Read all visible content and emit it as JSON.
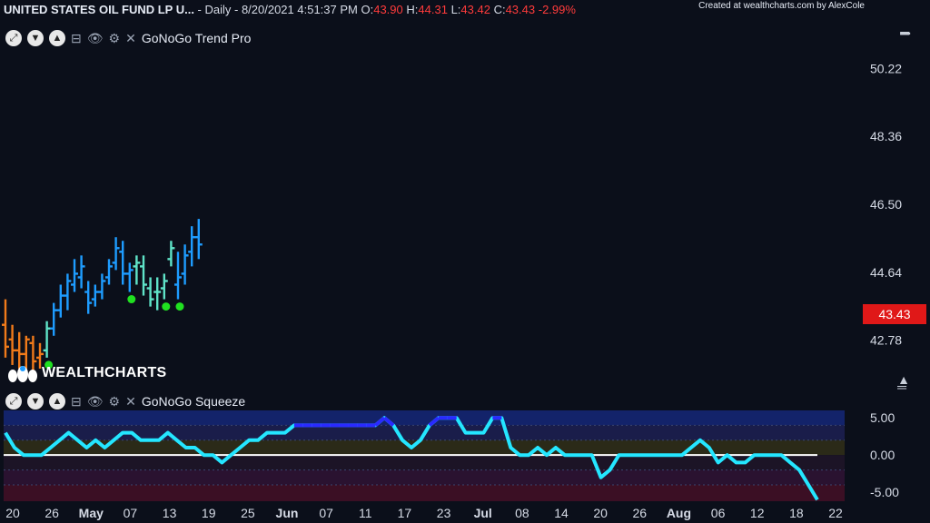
{
  "header": {
    "symbol": "UNITED STATES OIL FUND LP U...",
    "info": " - Daily - 8/20/2021 4:51:37 PM O:",
    "open": "43.90",
    "h_label": "H:",
    "high": "44.31",
    "l_label": "L:",
    "low": "43.42",
    "c_label": "C:",
    "close": "43.43",
    "change": "-2.99%",
    "credit": "Created at wealthcharts.com by AlexCole"
  },
  "top_panel": {
    "indicator_name": "GoNoGo Trend Pro",
    "last_price_label": "43.43"
  },
  "bottom_panel": {
    "indicator_name": "GoNoGo Squeeze"
  },
  "logo": {
    "text": "WEALTHCHARTS"
  },
  "icons": {
    "collapse": "square-minus-icon",
    "visibility": "eye-icon",
    "settings": "gear-icon",
    "close": "close-icon"
  },
  "colors": {
    "background": "#0b0f1a",
    "go_strong": "#1e9cff",
    "go_weak": "#5fe3c8",
    "nogo_strong": "#b01ec0",
    "nogo_weak": "#f08be8",
    "neutral": "#f07a1a",
    "go_marker": "#20e020",
    "nogo_marker": "#ff1a1a",
    "squeeze_line": "#24e6ff",
    "squeeze_max": "#2a2aff",
    "zero_line": "#ffffff"
  },
  "chart_data": [
    {
      "type": "ohlc",
      "title": "UNITED STATES OIL FUND LP U...",
      "indicator": "GoNoGo Trend Pro",
      "y_ticks": [
        42.78,
        44.64,
        46.5,
        48.36,
        50.22
      ],
      "y_range": [
        41.9,
        51.4
      ],
      "x_tick_labels": [
        "20",
        "26",
        "May",
        "07",
        "13",
        "19",
        "25",
        "Jun",
        "07",
        "11",
        "17",
        "23",
        "Jul",
        "08",
        "14",
        "20",
        "26",
        "Aug",
        "06",
        "12",
        "18",
        "22"
      ],
      "last_price": 43.43,
      "bars": [
        {
          "d": "Apr-20",
          "o": 43.2,
          "h": 43.9,
          "l": 42.3,
          "c": 42.6,
          "col": "neutral"
        },
        {
          "d": "Apr-21",
          "o": 42.8,
          "h": 43.2,
          "l": 42.1,
          "c": 42.5,
          "col": "neutral"
        },
        {
          "d": "Apr-22",
          "o": 42.5,
          "h": 43.0,
          "l": 42.0,
          "c": 42.4,
          "col": "neutral"
        },
        {
          "d": "Apr-23",
          "o": 42.4,
          "h": 42.9,
          "l": 42.0,
          "c": 42.8,
          "col": "neutral"
        },
        {
          "d": "Apr-26",
          "o": 42.7,
          "h": 42.9,
          "l": 41.9,
          "c": 42.2,
          "col": "neutral"
        },
        {
          "d": "Apr-27",
          "o": 42.3,
          "h": 42.7,
          "l": 42.0,
          "c": 42.4,
          "col": "neutral"
        },
        {
          "d": "Apr-28",
          "o": 42.5,
          "h": 43.3,
          "l": 42.3,
          "c": 43.1,
          "col": "go_weak"
        },
        {
          "d": "Apr-29",
          "o": 43.1,
          "h": 43.8,
          "l": 42.9,
          "c": 43.6,
          "col": "go_strong"
        },
        {
          "d": "Apr-30",
          "o": 43.6,
          "h": 44.3,
          "l": 43.4,
          "c": 44.0,
          "col": "go_strong"
        },
        {
          "d": "May-03",
          "o": 44.0,
          "h": 44.6,
          "l": 43.6,
          "c": 44.4,
          "col": "go_strong"
        },
        {
          "d": "May-04",
          "o": 44.3,
          "h": 45.0,
          "l": 44.1,
          "c": 44.6,
          "col": "go_strong"
        },
        {
          "d": "May-05",
          "o": 44.5,
          "h": 45.1,
          "l": 44.2,
          "c": 44.8,
          "col": "go_strong"
        },
        {
          "d": "May-06",
          "o": 44.1,
          "h": 44.4,
          "l": 43.5,
          "c": 43.8,
          "col": "go_strong"
        },
        {
          "d": "May-07",
          "o": 43.9,
          "h": 44.3,
          "l": 43.7,
          "c": 44.1,
          "col": "go_strong"
        },
        {
          "d": "May-10",
          "o": 44.1,
          "h": 44.6,
          "l": 43.9,
          "c": 44.4,
          "col": "go_strong"
        },
        {
          "d": "May-11",
          "o": 44.5,
          "h": 45.0,
          "l": 44.3,
          "c": 44.8,
          "col": "go_strong"
        },
        {
          "d": "May-12",
          "o": 44.9,
          "h": 45.6,
          "l": 44.7,
          "c": 45.3,
          "col": "go_strong"
        },
        {
          "d": "May-13",
          "o": 45.2,
          "h": 45.5,
          "l": 44.3,
          "c": 44.6,
          "col": "go_strong"
        },
        {
          "d": "May-14",
          "o": 44.6,
          "h": 44.9,
          "l": 44.1,
          "c": 44.7,
          "col": "go_strong"
        },
        {
          "d": "May-17",
          "o": 44.8,
          "h": 45.1,
          "l": 44.3,
          "c": 44.9,
          "col": "go_weak"
        },
        {
          "d": "May-18",
          "o": 44.8,
          "h": 45.1,
          "l": 44.0,
          "c": 44.3,
          "col": "go_weak"
        },
        {
          "d": "May-19",
          "o": 44.2,
          "h": 44.5,
          "l": 43.7,
          "c": 43.9,
          "col": "go_weak"
        },
        {
          "d": "May-20",
          "o": 44.1,
          "h": 44.5,
          "l": 43.6,
          "c": 44.1,
          "col": "go_weak"
        },
        {
          "d": "May-21",
          "o": 44.2,
          "h": 44.6,
          "l": 43.9,
          "c": 44.4,
          "col": "go_weak"
        },
        {
          "d": "May-24",
          "o": 45.0,
          "h": 45.5,
          "l": 44.8,
          "c": 45.3,
          "col": "go_weak"
        },
        {
          "d": "May-25",
          "o": 44.3,
          "h": 45.2,
          "l": 43.9,
          "c": 44.5,
          "col": "go_strong"
        },
        {
          "d": "May-26",
          "o": 44.6,
          "h": 45.4,
          "l": 44.3,
          "c": 45.1,
          "col": "go_strong"
        },
        {
          "d": "May-27",
          "o": 45.2,
          "h": 45.9,
          "l": 44.8,
          "c": 45.6,
          "col": "go_strong"
        },
        {
          "d": "May-28",
          "o": 45.6,
          "h": 46.1,
          "l": 45.0,
          "c": 45.4,
          "col": "go_strong"
        }
      ],
      "go_markers": [
        "Apr-28",
        "May-14",
        "May-21",
        "May-25"
      ],
      "nogo_markers": []
    },
    {
      "type": "line",
      "title": "GoNoGo Squeeze",
      "y_ticks": [
        5.0,
        0.0,
        -5.0
      ],
      "y_tick_labels": [
        "5.00",
        "0.00",
        "-5.00"
      ],
      "y_range": [
        -6.2,
        6.0
      ],
      "series": [
        {
          "values": [
            3,
            1,
            0,
            0,
            0,
            1,
            2,
            3,
            2,
            1,
            2,
            1,
            2,
            3,
            3,
            2,
            2,
            2,
            3,
            2,
            1,
            1,
            0,
            0,
            -1,
            0,
            1,
            2,
            2,
            3,
            3,
            3,
            4,
            4,
            4,
            4,
            4,
            4,
            4,
            4,
            4,
            4,
            5,
            4,
            2,
            1,
            2,
            4,
            5,
            5,
            5,
            3,
            3,
            3,
            5,
            5,
            1,
            0,
            0,
            1,
            0,
            1,
            0,
            0,
            0,
            0,
            -3,
            -2,
            0,
            0,
            0,
            0,
            0,
            0,
            0,
            0,
            1,
            2,
            1,
            -1,
            0,
            -1,
            -1,
            0,
            0,
            0,
            0,
            -1,
            -2,
            -4,
            -6
          ]
        }
      ]
    }
  ]
}
